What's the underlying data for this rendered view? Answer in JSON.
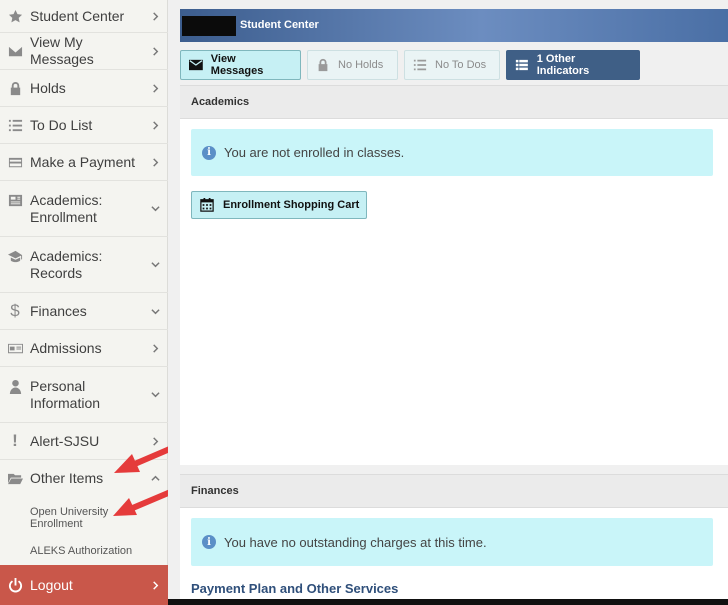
{
  "sidebar": {
    "items": [
      {
        "label": "Student Center",
        "icon": "star-icon",
        "chevron": "right"
      },
      {
        "label": "View My Messages",
        "icon": "envelope-icon",
        "chevron": "right"
      },
      {
        "label": "Holds",
        "icon": "lock-icon",
        "chevron": "right"
      },
      {
        "label": "To Do List",
        "icon": "list-icon",
        "chevron": "right"
      },
      {
        "label": "Make a Payment",
        "icon": "credit-card-icon",
        "chevron": "right"
      },
      {
        "label": "Academics: Enrollment",
        "icon": "newspaper-icon",
        "chevron": "down"
      },
      {
        "label": "Academics: Records",
        "icon": "graduation-cap-icon",
        "chevron": "down"
      },
      {
        "label": "Finances",
        "icon": "dollar-icon",
        "chevron": "down"
      },
      {
        "label": "Admissions",
        "icon": "id-card-icon",
        "chevron": "right"
      },
      {
        "label": "Personal Information",
        "icon": "user-icon",
        "chevron": "down"
      },
      {
        "label": "Alert-SJSU",
        "icon": "exclamation-icon",
        "chevron": "right"
      },
      {
        "label": "Other Items",
        "icon": "folder-open-icon",
        "chevron": "up"
      }
    ],
    "sub_items": [
      "Open University Enrollment",
      "ALEKS Authorization"
    ],
    "logout_label": "Logout"
  },
  "header": {
    "title": "Student Center"
  },
  "indicators": [
    {
      "label": "View Messages",
      "icon": "envelope-icon",
      "state": "active"
    },
    {
      "label": "No Holds",
      "icon": "lock-icon",
      "state": "disabled"
    },
    {
      "label": "No To Dos",
      "icon": "list-icon",
      "state": "disabled"
    },
    {
      "label": "1 Other Indicators",
      "icon": "list-icon",
      "state": "dark"
    }
  ],
  "academics": {
    "heading": "Academics",
    "notice": "You are not enrolled in classes.",
    "cart_button": "Enrollment Shopping Cart"
  },
  "finances": {
    "heading": "Finances",
    "notice": "You have no outstanding charges at this time.",
    "link_heading": "Payment Plan and Other Services"
  },
  "colors": {
    "accent": "#c6f0f4",
    "logout": "#c9574a",
    "header": "#4a6fa5",
    "arrow": "#e53b3b"
  }
}
